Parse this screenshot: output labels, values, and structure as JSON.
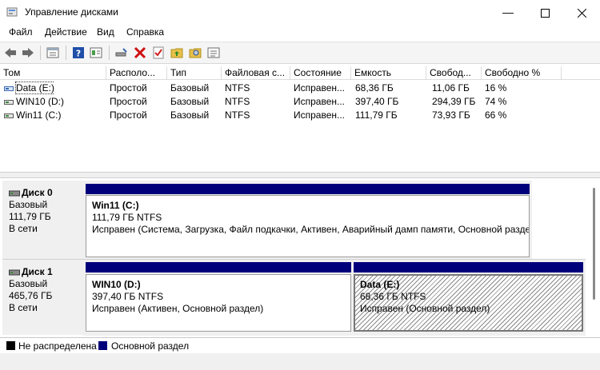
{
  "window": {
    "title": "Управление дисками"
  },
  "menu": [
    "Файл",
    "Действие",
    "Вид",
    "Справка"
  ],
  "columns": [
    "Том",
    "Располо...",
    "Тип",
    "Файловая с...",
    "Состояние",
    "Емкость",
    "Свобод...",
    "Свободно %"
  ],
  "volumes": [
    {
      "name": "Data (E:)",
      "layout": "Простой",
      "type": "Базовый",
      "fs": "NTFS",
      "status": "Исправен...",
      "capacity": "68,36 ГБ",
      "free": "11,06 ГБ",
      "free_pct": "16 %"
    },
    {
      "name": "WIN10 (D:)",
      "layout": "Простой",
      "type": "Базовый",
      "fs": "NTFS",
      "status": "Исправен...",
      "capacity": "397,40 ГБ",
      "free": "294,39 ГБ",
      "free_pct": "74 %"
    },
    {
      "name": "Win11 (C:)",
      "layout": "Простой",
      "type": "Базовый",
      "fs": "NTFS",
      "status": "Исправен...",
      "capacity": "111,79 ГБ",
      "free": "73,93 ГБ",
      "free_pct": "66 %"
    }
  ],
  "disks": [
    {
      "name": "Диск 0",
      "type": "Базовый",
      "size": "111,79 ГБ",
      "state": "В сети",
      "partitions": [
        {
          "name": "Win11  (C:)",
          "size": "111,79 ГБ NTFS",
          "status": "Исправен (Система, Загрузка, Файл подкачки, Активен, Аварийный дамп памяти, Основной разде"
        }
      ]
    },
    {
      "name": "Диск 1",
      "type": "Базовый",
      "size": "465,76 ГБ",
      "state": "В сети",
      "partitions": [
        {
          "name": "WIN10  (D:)",
          "size": "397,40 ГБ NTFS",
          "status": "Исправен (Активен, Основной раздел)"
        },
        {
          "name": "Data  (E:)",
          "size": "68,36 ГБ NTFS",
          "status": "Исправен (Основной раздел)"
        }
      ]
    }
  ],
  "legend": {
    "unallocated": "Не распределена",
    "primary": "Основной раздел",
    "unallocated_color": "#000000",
    "primary_color": "#00007b"
  },
  "icons": [
    "back-icon",
    "forward-icon",
    "properties-icon",
    "help-icon",
    "refresh-icon",
    "connect-icon",
    "delete-icon",
    "check-icon",
    "up-folder-icon",
    "search-folder-icon",
    "list-icon"
  ]
}
